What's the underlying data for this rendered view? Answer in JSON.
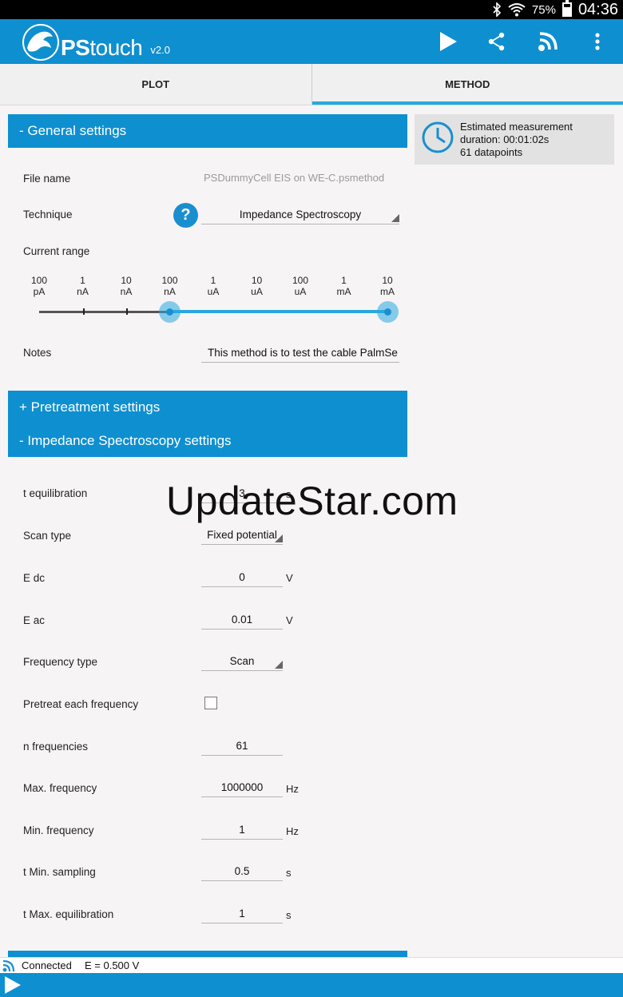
{
  "status_bar": {
    "battery": "75%",
    "battery_level": 0.75,
    "time": "04:36",
    "icons": [
      "bluetooth-icon",
      "wifi-icon",
      "battery-icon"
    ]
  },
  "app_bar": {
    "brand_prefix": "PS",
    "brand_suffix": "touch",
    "version": "v2.0",
    "actions": [
      "play-icon",
      "share-icon",
      "connect-icon",
      "overflow-menu-icon"
    ],
    "color": "#0e8fd0"
  },
  "tabs": [
    {
      "label": "PLOT",
      "active": false
    },
    {
      "label": "METHOD",
      "active": true
    }
  ],
  "estimate": {
    "line1": "Estimated measurement",
    "line2": "duration: 00:01:02s",
    "line3": "61 datapoints",
    "icon": "clock-icon"
  },
  "general": {
    "header": "- General settings",
    "file_name_label": "File name",
    "file_name_value": "PSDummyCell EIS on WE-C.psmethod",
    "technique_label": "Technique",
    "technique_value": "Impedance Spectroscopy",
    "help_glyph": "?",
    "current_range_label": "Current range",
    "current_range_ticks": [
      {
        "v": "100",
        "u": "pA"
      },
      {
        "v": "1",
        "u": "nA"
      },
      {
        "v": "10",
        "u": "nA"
      },
      {
        "v": "100",
        "u": "nA"
      },
      {
        "v": "1",
        "u": "uA"
      },
      {
        "v": "10",
        "u": "uA"
      },
      {
        "v": "100",
        "u": "uA"
      },
      {
        "v": "1",
        "u": "mA"
      },
      {
        "v": "10",
        "u": "mA"
      }
    ],
    "current_range_min": "100 nA",
    "current_range_max": "10 mA",
    "notes_label": "Notes",
    "notes_value": "This method is to test the cable PalmSe"
  },
  "pretreatment": {
    "header": "+ Pretreatment settings"
  },
  "eis": {
    "header": "- Impedance Spectroscopy settings",
    "t_equilibration": {
      "label": "t equilibration",
      "value": "3",
      "unit": "s"
    },
    "scan_type": {
      "label": "Scan type",
      "value": "Fixed potential"
    },
    "e_dc": {
      "label": "E dc",
      "value": "0",
      "unit": "V"
    },
    "e_ac": {
      "label": "E ac",
      "value": "0.01",
      "unit": "V"
    },
    "frequency_type": {
      "label": "Frequency type",
      "value": "Scan"
    },
    "pretreat_each": {
      "label": "Pretreat each frequency",
      "checked": false
    },
    "n_frequencies": {
      "label": "n frequencies",
      "value": "61"
    },
    "max_frequency": {
      "label": "Max. frequency",
      "value": "1000000",
      "unit": "Hz"
    },
    "min_frequency": {
      "label": "Min. frequency",
      "value": "1",
      "unit": "Hz"
    },
    "t_min_sampling": {
      "label": "t Min. sampling",
      "value": "0.5",
      "unit": "s"
    },
    "t_max_equilibration": {
      "label": "t Max. equilibration",
      "value": "1",
      "unit": "s"
    }
  },
  "watermark": "UpdateStar.com",
  "footer": {
    "connection": "Connected",
    "potential": "E = 0.500 V"
  }
}
